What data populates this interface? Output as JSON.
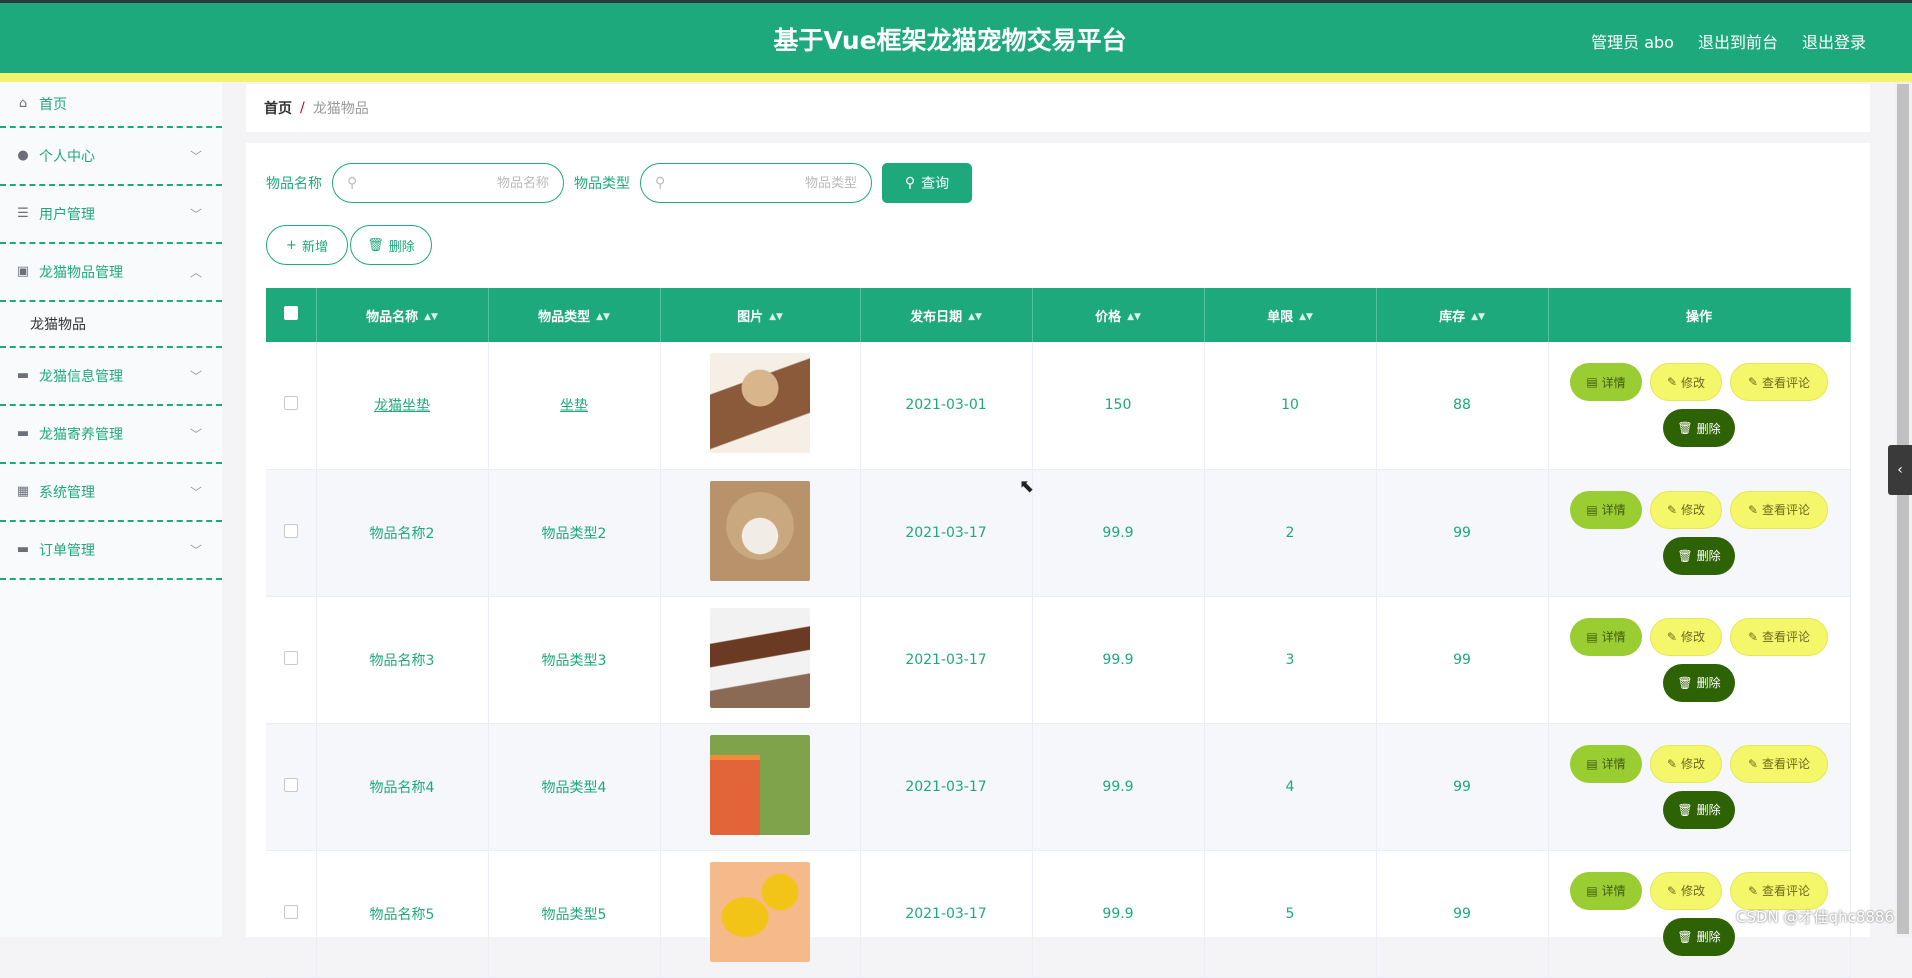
{
  "header": {
    "title": "基于Vue框架龙猫宠物交易平台",
    "user": "管理员 abo",
    "to_front": "退出到前台",
    "logout": "退出登录"
  },
  "sidebar": {
    "items": [
      {
        "label": "首页",
        "icon": "home-icon",
        "glyph": "⌂",
        "has_chevron": false
      },
      {
        "label": "个人中心",
        "icon": "user-icon",
        "glyph": "●",
        "has_chevron": true
      },
      {
        "label": "用户管理",
        "icon": "list-icon",
        "glyph": "☰",
        "has_chevron": true
      },
      {
        "label": "龙猫物品管理",
        "icon": "clipboard-icon",
        "glyph": "▣",
        "has_chevron": true,
        "expanded": true
      },
      {
        "label": "龙猫信息管理",
        "icon": "chat-icon",
        "glyph": "▬",
        "has_chevron": true
      },
      {
        "label": "龙猫寄养管理",
        "icon": "briefcase-icon",
        "glyph": "▬",
        "has_chevron": true
      },
      {
        "label": "系统管理",
        "icon": "grid-icon",
        "glyph": "▦",
        "has_chevron": true
      },
      {
        "label": "订单管理",
        "icon": "printer-icon",
        "glyph": "▬",
        "has_chevron": true
      }
    ],
    "submenu": "龙猫物品"
  },
  "breadcrumb": {
    "home": "首页",
    "sep": "/",
    "current": "龙猫物品"
  },
  "search": {
    "name_label": "物品名称",
    "name_placeholder": "物品名称",
    "type_label": "物品类型",
    "type_placeholder": "物品类型",
    "query": "查询"
  },
  "actions": {
    "add": "新增",
    "delete": "删除"
  },
  "table": {
    "columns": [
      "物品名称",
      "物品类型",
      "图片",
      "发布日期",
      "价格",
      "单限",
      "库存",
      "操作"
    ],
    "ops": {
      "detail": "详情",
      "edit": "修改",
      "review": "查看评论",
      "delete": "删除"
    },
    "rows": [
      {
        "name": "龙猫坐垫",
        "type": "坐垫",
        "image": "pet-bed-photo",
        "date": "2021-03-01",
        "price": "150",
        "limit": "10",
        "stock": "88",
        "linked": true
      },
      {
        "name": "物品名称2",
        "type": "物品类型2",
        "image": "dog-in-hoodie-photo",
        "date": "2021-03-17",
        "price": "99.9",
        "limit": "2",
        "stock": "99",
        "linked": false
      },
      {
        "name": "物品名称3",
        "type": "物品类型3",
        "image": "collar-photo",
        "date": "2021-03-17",
        "price": "99.9",
        "limit": "3",
        "stock": "99",
        "linked": false
      },
      {
        "name": "物品名称4",
        "type": "物品类型4",
        "image": "pet-tent-photo",
        "date": "2021-03-17",
        "price": "99.9",
        "limit": "4",
        "stock": "99",
        "linked": false
      },
      {
        "name": "物品名称5",
        "type": "物品类型5",
        "image": "rubber-chicken-photo",
        "date": "2021-03-17",
        "price": "99.9",
        "limit": "5",
        "stock": "99",
        "linked": false
      }
    ]
  },
  "watermark": "CSDN @才佳qhc8886",
  "colors": {
    "primary": "#1ea97c",
    "accent_yellow": "#f2f56b",
    "dark_green": "#2e6305",
    "lime": "#9acd32"
  }
}
